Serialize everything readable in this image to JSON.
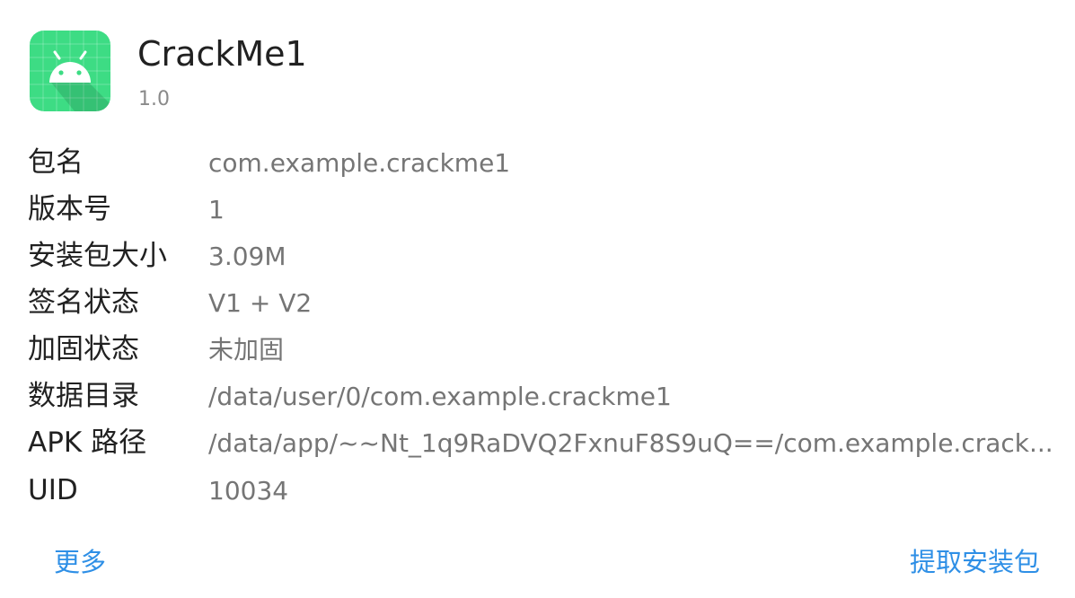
{
  "app": {
    "name": "CrackMe1",
    "version": "1.0",
    "icon": "android-robot-icon",
    "icon_bg_color": "#3ddc84"
  },
  "info": [
    {
      "label": "包名",
      "value": "com.example.crackme1"
    },
    {
      "label": "版本号",
      "value": "1"
    },
    {
      "label": "安装包大小",
      "value": "3.09M"
    },
    {
      "label": "签名状态",
      "value": "V1 + V2"
    },
    {
      "label": "加固状态",
      "value": "未加固"
    },
    {
      "label": "数据目录",
      "value": "/data/user/0/com.example.crackme1"
    },
    {
      "label": "APK 路径",
      "value": "/data/app/~~Nt_1q9RaDVQ2FxnuF8S9uQ==/com.example.crack..."
    },
    {
      "label": "UID",
      "value": "10034"
    }
  ],
  "actions": {
    "more": "更多",
    "extract": "提取安装包",
    "accent_color": "#2e8fe6"
  }
}
